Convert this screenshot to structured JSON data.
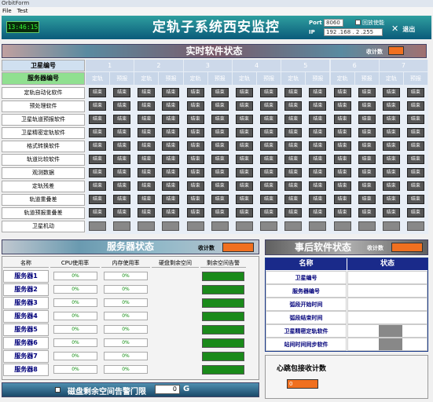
{
  "window": {
    "title": "OrbitForm"
  },
  "menu": [
    "File",
    "Test"
  ],
  "header": {
    "clock": "13:46:15",
    "title": "定轨子系统西安监控",
    "port_label": "Port",
    "port_value": "8060",
    "ip_label": "IP",
    "ip_value": "192 .168 . 2 .255",
    "checkbox_label": "回放使能",
    "exit_label": "退出"
  },
  "realtime": {
    "title": "实时软件状态",
    "count_label": "收计数",
    "sat_label": "卫星编号",
    "srv_label": "服务器编号",
    "groups": [
      "1",
      "2",
      "3",
      "4",
      "5",
      "6",
      "7"
    ],
    "sub": [
      "定轨",
      "预报"
    ],
    "rows": [
      "定轨自动化软件",
      "预处理软件",
      "卫星轨道预报软件",
      "卫星精密定轨软件",
      "格式转换软件",
      "轨道比较软件",
      "观测数据",
      "定轨残差",
      "轨道重叠差",
      "轨道预报重叠差",
      "卫星机动"
    ],
    "button_label": "结束"
  },
  "servers": {
    "title": "服务器状态",
    "count_label": "收计数",
    "cols": [
      "名称",
      "CPU使用率",
      "内存使用率",
      "硬盘剩余空间",
      "剩余空间告警"
    ],
    "rows": [
      {
        "name": "服务器1",
        "cpu": "0%",
        "mem": "0%"
      },
      {
        "name": "服务器2",
        "cpu": "0%",
        "mem": "0%"
      },
      {
        "name": "服务器3",
        "cpu": "0%",
        "mem": "0%"
      },
      {
        "name": "服务器4",
        "cpu": "0%",
        "mem": "0%"
      },
      {
        "name": "服务器5",
        "cpu": "0%",
        "mem": "0%"
      },
      {
        "name": "服务器6",
        "cpu": "0%",
        "mem": "0%"
      },
      {
        "name": "服务器7",
        "cpu": "0%",
        "mem": "0%"
      },
      {
        "name": "服务器8",
        "cpu": "0%",
        "mem": "0%"
      }
    ]
  },
  "disk": {
    "label": "磁盘剩余空间告警门限",
    "value": "0",
    "unit": "G"
  },
  "post": {
    "title": "事后软件状态",
    "count_label": "收计数",
    "cols": [
      "名称",
      "状态"
    ],
    "rows": [
      "卫星编号",
      "服务器编号",
      "弧段开始时间",
      "弧段结束时间",
      "卫星精密定轨软件",
      "站间时间同步软件"
    ]
  },
  "heartbeat": {
    "label": "心跳包接收计数",
    "value": "0"
  }
}
